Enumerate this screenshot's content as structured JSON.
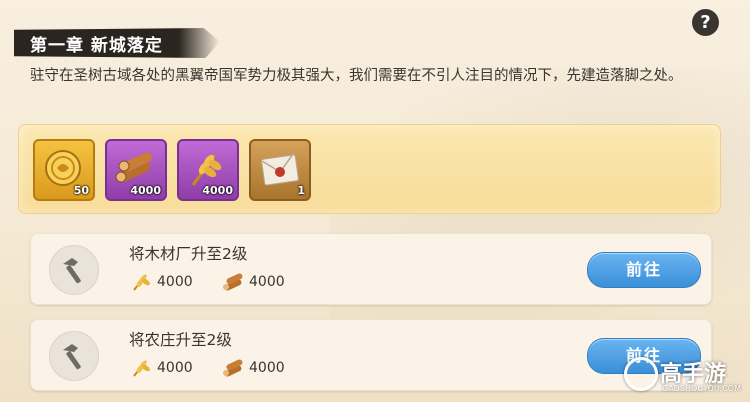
{
  "chapter_title": "第一章 新城落定",
  "help_label": "?",
  "description": "驻守在圣树古域各处的黑翼帝国军势力极其强大，我们需要在不引人注目的情况下，先建造落脚之处。",
  "rewards": [
    {
      "icon": "gold-coin-icon",
      "qty": "50"
    },
    {
      "icon": "wood-icon",
      "qty": "4000"
    },
    {
      "icon": "wheat-icon",
      "qty": "4000"
    },
    {
      "icon": "letter-icon",
      "qty": "1"
    }
  ],
  "tasks": [
    {
      "label": "将木材厂升至2级",
      "wheat_cost": "4000",
      "wood_cost": "4000",
      "button": "前往"
    },
    {
      "label": "将农庄升至2级",
      "wheat_cost": "4000",
      "wood_cost": "4000",
      "button": "前往"
    }
  ],
  "watermark": {
    "text": "高手游",
    "subtext": "GAOSHOUYOU.COM"
  },
  "colors": {
    "accent_blue": "#3a8fd8",
    "reward_panel": "#f7dc98",
    "title_bg": "#2b2520"
  }
}
